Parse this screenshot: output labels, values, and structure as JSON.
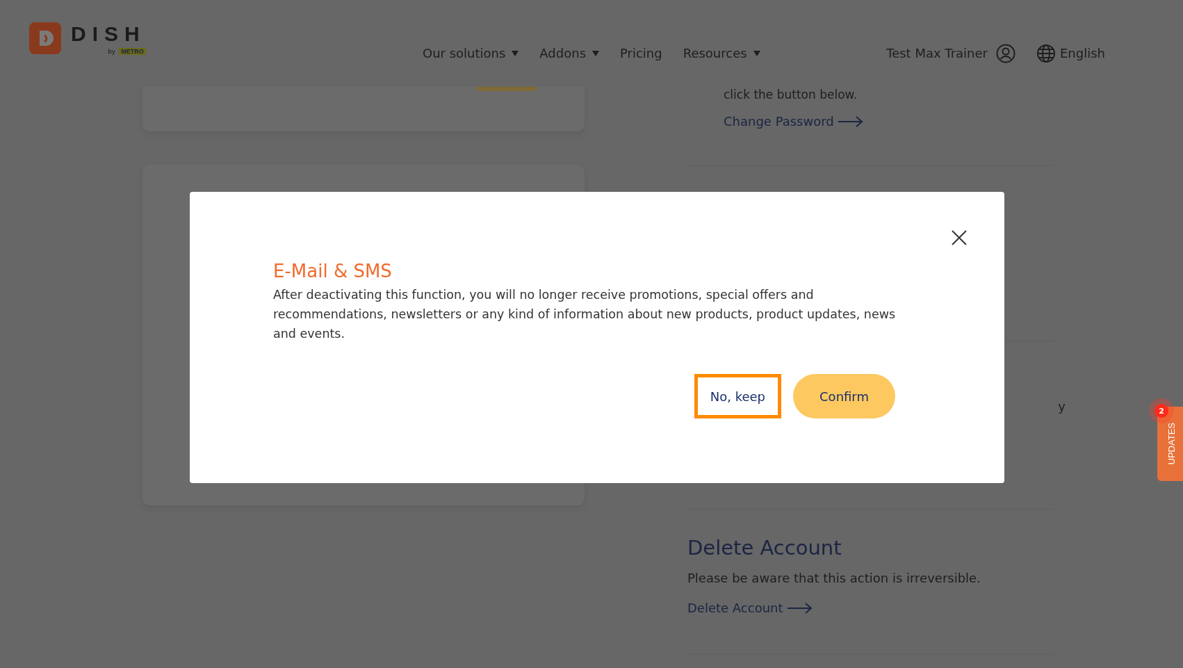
{
  "header": {
    "logo": {
      "wordmark": "DISH",
      "byline": "by",
      "brand": "METRO"
    },
    "nav": [
      {
        "label": "Our solutions",
        "dropdown": true
      },
      {
        "label": "Addons",
        "dropdown": true
      },
      {
        "label": "Pricing",
        "dropdown": false
      },
      {
        "label": "Resources",
        "dropdown": true
      }
    ],
    "user": {
      "name": "Test Max Trainer"
    },
    "language": "English"
  },
  "right_column": {
    "cut_text": "click the button below.",
    "change_password_link": "Change Password",
    "fragment": "y",
    "delete_account": {
      "title": "Delete Account",
      "text": "Please be aware that this action is irreversible.",
      "link": "Delete Account"
    }
  },
  "modal": {
    "title": "E-Mail & SMS",
    "body": "After deactivating this function, you will no longer receive promotions, special offers and recommendations, newsletters or any kind of information about new products, product updates, news and events.",
    "buttons": [
      {
        "label": "No, keep",
        "kind": "secondary",
        "focused": true
      },
      {
        "label": "Confirm",
        "kind": "primary",
        "focused": false
      }
    ]
  },
  "updates_tab": {
    "label": "UPDATES",
    "badge": "2"
  }
}
